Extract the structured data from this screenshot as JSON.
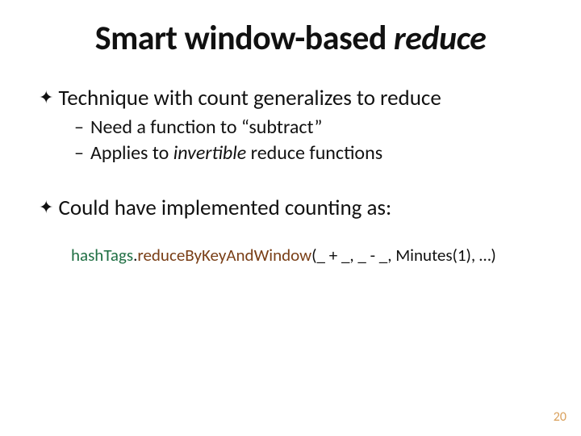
{
  "title": {
    "prefix": "Smart window-based ",
    "italic": "reduce"
  },
  "bullets": {
    "b1": "Technique with count generalizes to reduce",
    "b1_sub1": "Need a function to “subtract”",
    "b1_sub2_prefix": "Applies to ",
    "b1_sub2_italic": "invertible",
    "b1_sub2_suffix": " reduce functions",
    "b2": "Could have implemented counting as:"
  },
  "code": {
    "part1": "hashTags",
    "dot1": ".",
    "part2": "reduceByKeyAndWindow",
    "part3": "(_ + _, _ - _, Minutes(1), …)"
  },
  "markers": {
    "diamond": "✦",
    "dash": "–"
  },
  "page": "20"
}
